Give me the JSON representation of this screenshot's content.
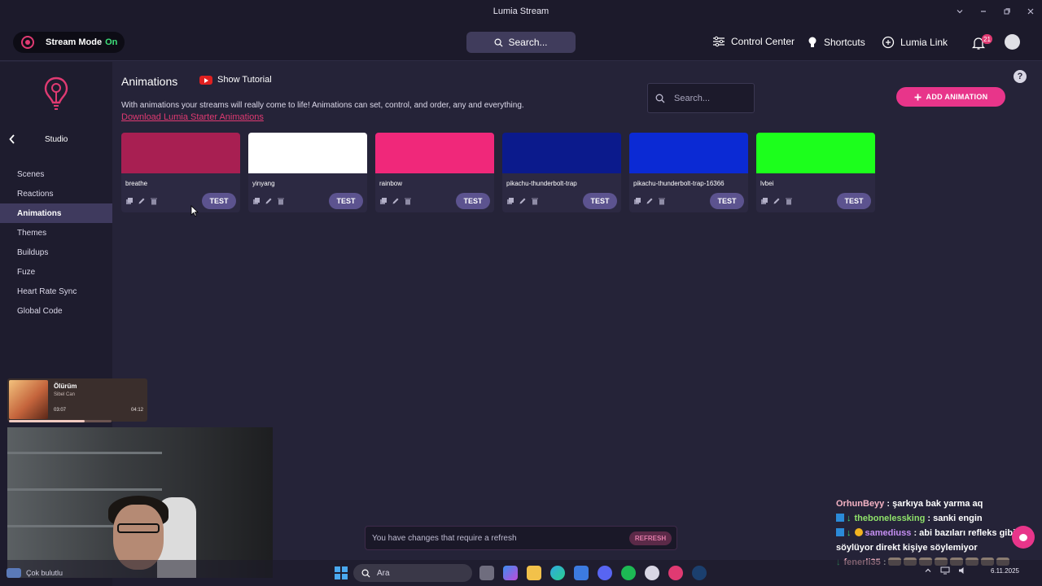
{
  "window": {
    "title": "Lumia Stream",
    "controls": [
      "chevron-down",
      "minimize",
      "restore",
      "close"
    ]
  },
  "topnav": {
    "stream_mode_label": "Stream Mode",
    "stream_mode_state": "On",
    "search_placeholder": "Search...",
    "control_center": "Control Center",
    "shortcuts": "Shortcuts",
    "lumia_link": "Lumia Link",
    "notification_count": "21"
  },
  "sidebar": {
    "section": "Studio",
    "items": [
      {
        "label": "Scenes"
      },
      {
        "label": "Reactions"
      },
      {
        "label": "Animations"
      },
      {
        "label": "Themes"
      },
      {
        "label": "Buildups"
      },
      {
        "label": "Fuze"
      },
      {
        "label": "Heart Rate Sync"
      },
      {
        "label": "Global Code"
      }
    ],
    "active_index": 2
  },
  "main": {
    "title": "Animations",
    "tutorial_label": "Show Tutorial",
    "description": "With animations your streams will really come to life! Animations can set, control, and order, any and everything.",
    "download_link": "Download Lumia Starter Animations",
    "search_placeholder": "Search...",
    "add_button": "ADD ANIMATION",
    "help": "?",
    "test_label": "TEST",
    "cards": [
      {
        "name": "breathe",
        "color": "#a81f52"
      },
      {
        "name": "yinyang",
        "color": "#ffffff"
      },
      {
        "name": "rainbow",
        "color": "#f0287a"
      },
      {
        "name": "pikachu-thunderbolt-trap",
        "color": "#0b1a8c"
      },
      {
        "name": "pikachu-thunderbolt-trap-16366",
        "color": "#0b2ad4"
      },
      {
        "name": "lvbei",
        "color": "#1cff1c"
      }
    ]
  },
  "now_playing": {
    "title": "Ölürüm",
    "artist": "Sibel Can",
    "elapsed": "03:07",
    "duration": "04:12",
    "progress": 0.74
  },
  "refresh_bar": {
    "message": "You have changes that require a refresh",
    "button": "REFRESH"
  },
  "chat": [
    {
      "user": "OrhunBeyy",
      "text": ": şarkıya bak yarma aq",
      "style": "pink",
      "badges": []
    },
    {
      "user": "thebonelessking",
      "text": ": sanki engin",
      "style": "green",
      "badges": [
        "prime",
        "arrow"
      ]
    },
    {
      "user": "samediuss",
      "text": ": abi bazıları refleks gibi",
      "style": "purple",
      "badges": [
        "prime",
        "arrow",
        "gold"
      ]
    },
    {
      "user": "",
      "text": "söylüyor direkt kişiye söylemiyor",
      "style": "",
      "badges": []
    },
    {
      "user": "fenerli35",
      "text": ":",
      "style": "pink",
      "badges": [
        "arrow"
      ]
    }
  ],
  "taskbar": {
    "weather_label": "Çok bulutlu",
    "search_placeholder": "Ara",
    "date": "6.11.2025"
  },
  "colors": {
    "accent": "#e8358a",
    "test_button": "#5c538f",
    "stream_on": "#3ee07a"
  }
}
